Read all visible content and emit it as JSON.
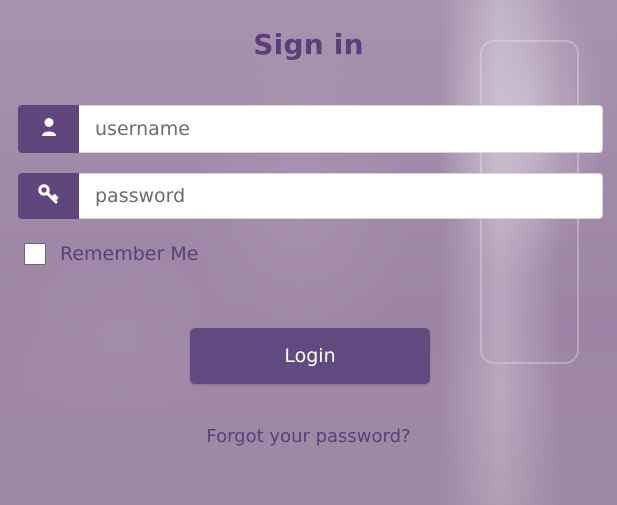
{
  "page": {
    "title": "Sign in"
  },
  "form": {
    "username": {
      "placeholder": "username",
      "value": "",
      "icon": "user-icon"
    },
    "password": {
      "placeholder": "password",
      "value": "",
      "icon": "key-icon"
    },
    "remember": {
      "label": "Remember Me",
      "checked": false
    },
    "login_label": "Login",
    "forgot_label": "Forgot your password?"
  },
  "colors": {
    "accent": "#614a80",
    "title": "#5d3e7c",
    "link": "#5a3f78"
  }
}
